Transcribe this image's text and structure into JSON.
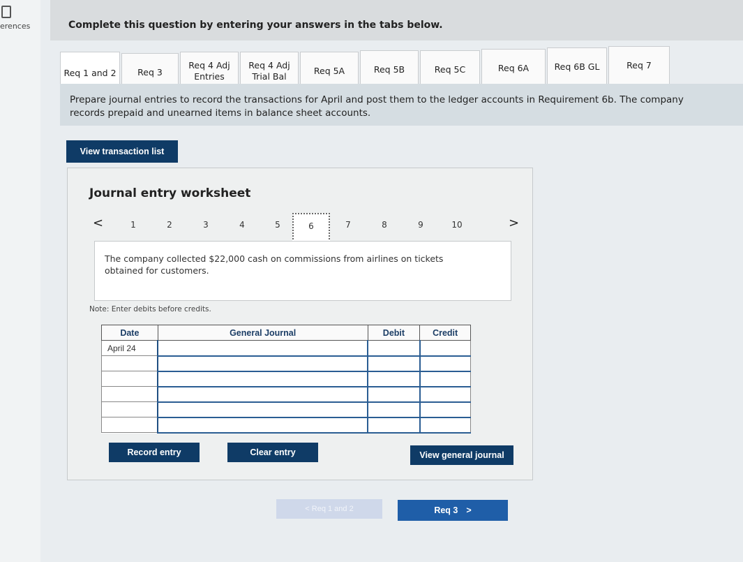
{
  "sidebar": {
    "label": "erences",
    "icon": "document-icon"
  },
  "header": {
    "title": "Complete this question by entering your answers in the tabs below."
  },
  "tabs": [
    {
      "line1": "Req 1 and 2",
      "line2": ""
    },
    {
      "line1": "Req 3",
      "line2": ""
    },
    {
      "line1": "Req 4 Adj",
      "line2": "Entries"
    },
    {
      "line1": "Req 4 Adj",
      "line2": "Trial Bal"
    },
    {
      "line1": "Req 5A",
      "line2": ""
    },
    {
      "line1": "Req 5B",
      "line2": ""
    },
    {
      "line1": "Req 5C",
      "line2": ""
    },
    {
      "line1": "Req 6A",
      "line2": ""
    },
    {
      "line1": "Req 6B GL",
      "line2": ""
    },
    {
      "line1": "Req 7",
      "line2": ""
    }
  ],
  "instructions": "Prepare journal entries to record the transactions for April and post them to the ledger accounts in Requirement 6b. The company records prepaid and unearned items in balance sheet accounts.",
  "view_transaction_list": "View transaction list",
  "worksheet": {
    "title": "Journal entry worksheet",
    "pages": [
      "1",
      "2",
      "3",
      "4",
      "5",
      "6",
      "7",
      "8",
      "9",
      "10"
    ],
    "active_page": "6",
    "prev_arrow": "<",
    "next_arrow": ">",
    "description": "The company collected $22,000 cash on commissions from airlines on tickets obtained for customers.",
    "note": "Note: Enter debits before credits.",
    "table": {
      "headers": {
        "date": "Date",
        "journal": "General Journal",
        "debit": "Debit",
        "credit": "Credit"
      },
      "first_date": "April 24"
    },
    "buttons": {
      "record": "Record entry",
      "clear": "Clear entry",
      "view_general": "View general journal"
    }
  },
  "bottom_nav": {
    "prev": "< Req 1 and 2",
    "next": "Req 3",
    "next_arrow": ">"
  },
  "colors": {
    "button_dark": "#0f3b66",
    "nav_button": "#1f5ea8",
    "table_header_text": "#1c3e66"
  }
}
